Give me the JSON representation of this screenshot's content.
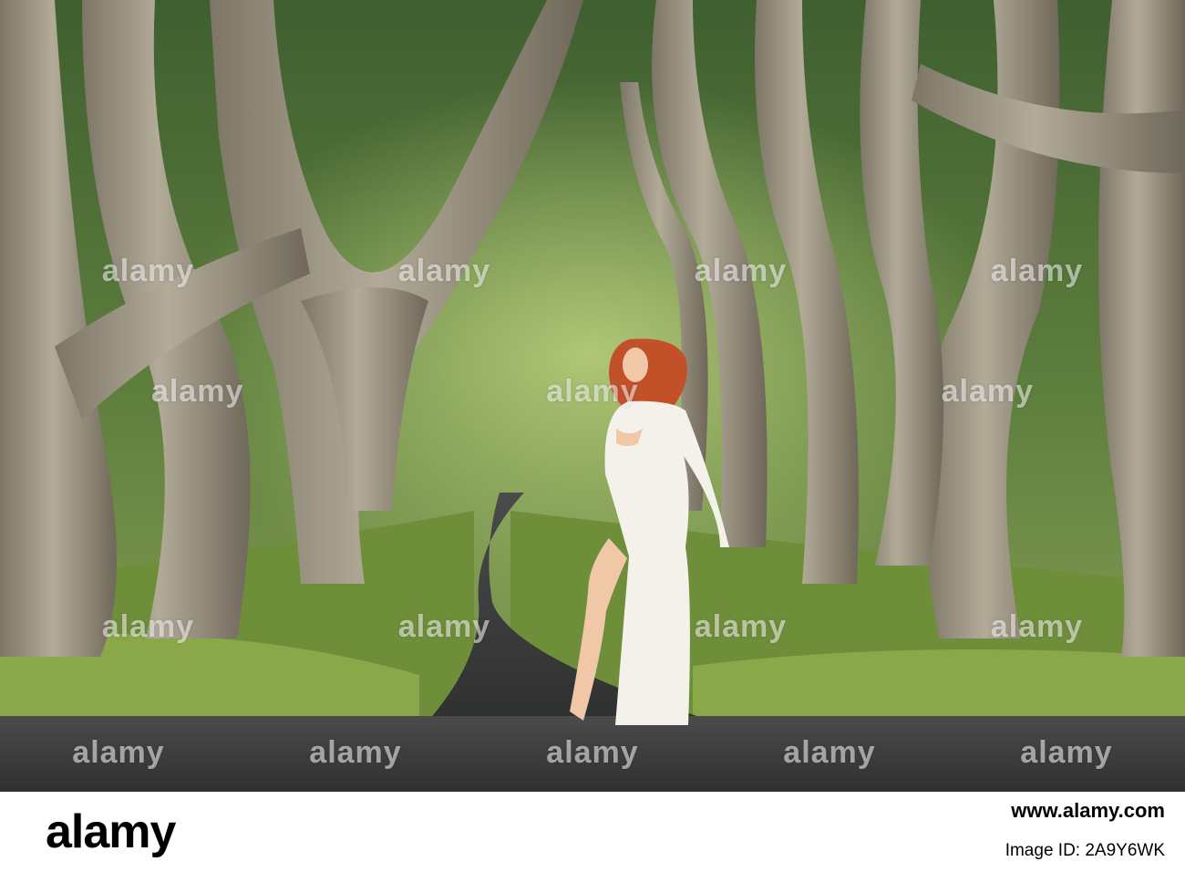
{
  "photo": {
    "subject": "woman in white robe on road",
    "watermark_text": "alamy",
    "colors": {
      "bark": "#a59d8a",
      "foliage": "#4f6b36",
      "road": "#3a3b3b",
      "dress": "#f4f1ea",
      "hair": "#c2512a"
    }
  },
  "footer": {
    "logo_text": "alamy",
    "image_id": "Image ID: 2A9Y6WK",
    "url": "www.alamy.com"
  }
}
